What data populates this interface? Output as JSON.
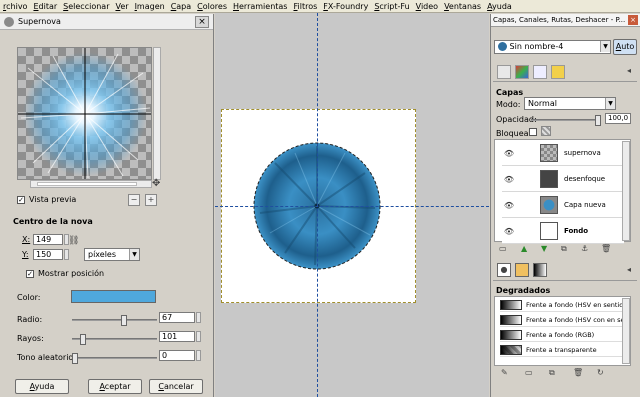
{
  "menubar": {
    "items": [
      "rchivo",
      "Editar",
      "Seleccionar",
      "Ver",
      "Imagen",
      "Capa",
      "Colores",
      "Herramientas",
      "Filtros",
      "FX-Foundry",
      "Script-Fu",
      "Video",
      "Ventanas",
      "Ayuda"
    ]
  },
  "dialog": {
    "title": "Supernova",
    "close": "×",
    "preview_label": "Vista previa",
    "preview_checked": true,
    "section_center": "Centro de la nova",
    "x_label": "X:",
    "x_value": "149",
    "y_label": "Y:",
    "y_value": "150",
    "unit": "píxeles",
    "show_position_label": "Mostrar posición",
    "show_position_checked": true,
    "color_label": "Color:",
    "color_value": "#4fa8dd",
    "radius_label": "Radio:",
    "radius_value": "67",
    "radius_fraction": 0.62,
    "rays_label": "Rayos:",
    "rays_value": "101",
    "rays_fraction": 0.1,
    "hue_label": "Tono aleatorio:",
    "hue_value": "0",
    "hue_fraction": 0.0,
    "help_button": "Ayuda",
    "ok_button": "Aceptar",
    "cancel_button": "Cancelar"
  },
  "panel": {
    "title": "Capas, Canales, Rutas, Deshacer - P...",
    "close": "×",
    "image_name": "Sin nombre-4",
    "auto_button": "Auto",
    "layers_heading": "Capas",
    "mode_label": "Modo:",
    "mode_value": "Normal",
    "opacity_label": "Opacidad:",
    "opacity_value": "100,0",
    "lock_label": "Bloquear:",
    "layers": [
      {
        "name": "supernova",
        "bold": false
      },
      {
        "name": "desenfoque",
        "bold": false
      },
      {
        "name": "Capa nueva",
        "bold": false
      },
      {
        "name": "Fondo",
        "bold": true
      }
    ],
    "gradients_heading": "Degradados",
    "gradients": [
      "Frente a fondo (HSV en sentido",
      "Frente a fondo (HSV con en se",
      "Frente a fondo (RGB)",
      "Frente a transparente"
    ]
  }
}
